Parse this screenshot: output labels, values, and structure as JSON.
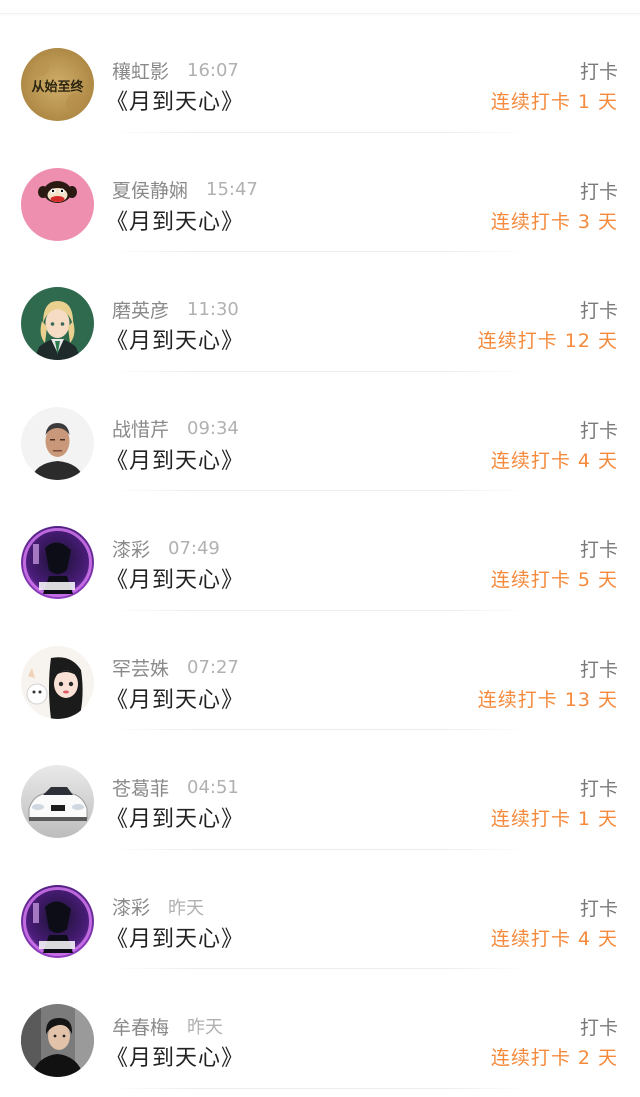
{
  "colors": {
    "streak_orange": "#f58a3c",
    "name_gray": "#8a8a8a",
    "time_gray": "#b1b1b1",
    "title_black": "#222222"
  },
  "feed": [
    {
      "user": "穰虹影",
      "time": "16:07",
      "book": "《月到天心》",
      "action": "打卡",
      "streak": "连续打卡 1 天",
      "avatar": "calligraphy-avatar",
      "avatar_text": "从始至终"
    },
    {
      "user": "夏侯静娴",
      "time": "15:47",
      "book": "《月到天心》",
      "action": "打卡",
      "streak": "连续打卡 3 天",
      "avatar": "monkey-avatar"
    },
    {
      "user": "磨英彦",
      "time": "11:30",
      "book": "《月到天心》",
      "action": "打卡",
      "streak": "连续打卡 12 天",
      "avatar": "anime-character-avatar"
    },
    {
      "user": "战惜芹",
      "time": "09:34",
      "book": "《月到天心》",
      "action": "打卡",
      "streak": "连续打卡 4 天",
      "avatar": "man-photo-avatar"
    },
    {
      "user": "漆彩",
      "time": "07:49",
      "book": "《月到天心》",
      "action": "打卡",
      "streak": "连续打卡 5 天",
      "avatar": "purple-art-avatar"
    },
    {
      "user": "罕芸姝",
      "time": "07:27",
      "book": "《月到天心》",
      "action": "打卡",
      "streak": "连续打卡 13 天",
      "avatar": "cartoon-girl-avatar"
    },
    {
      "user": "苍葛菲",
      "time": "04:51",
      "book": "《月到天心》",
      "action": "打卡",
      "streak": "连续打卡 1 天",
      "avatar": "car-avatar"
    },
    {
      "user": "漆彩",
      "time": "昨天",
      "book": "《月到天心》",
      "action": "打卡",
      "streak": "连续打卡 4 天",
      "avatar": "purple-art-avatar"
    },
    {
      "user": "牟春梅",
      "time": "昨天",
      "book": "《月到天心》",
      "action": "打卡",
      "streak": "连续打卡 2 天",
      "avatar": "young-man-photo-avatar"
    }
  ]
}
